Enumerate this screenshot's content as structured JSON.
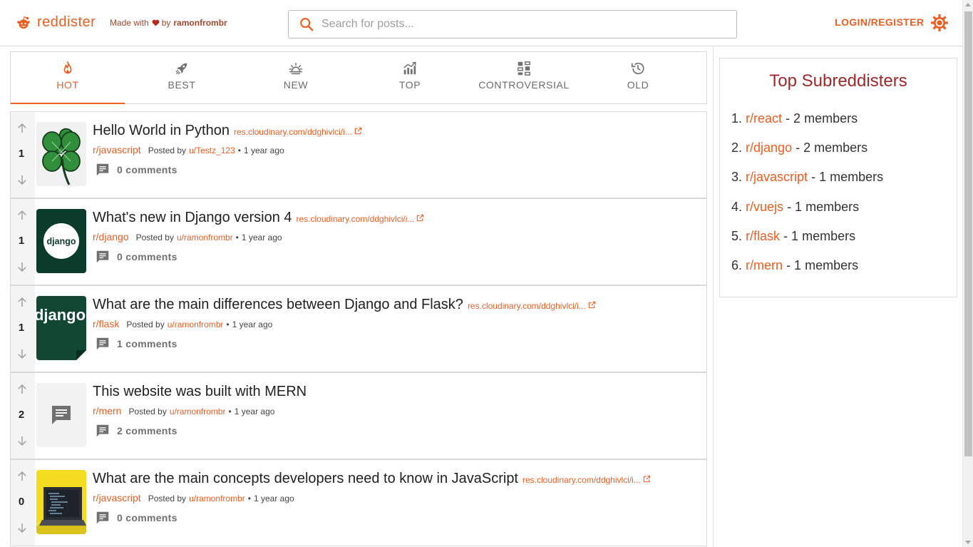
{
  "header": {
    "logo_text": "reddister",
    "made_with_prefix": "Made with",
    "made_with_by": "by",
    "made_with_author": "ramonfrombr",
    "search_placeholder": "Search for posts...",
    "login_label": "LOGIN/REGISTER"
  },
  "colors": {
    "accent": "#ee5d21",
    "sidebar_title": "#a1282a"
  },
  "tabs": [
    {
      "label": "HOT",
      "icon": "flame-icon",
      "active": true
    },
    {
      "label": "BEST",
      "icon": "rocket-icon",
      "active": false
    },
    {
      "label": "NEW",
      "icon": "sunrise-icon",
      "active": false
    },
    {
      "label": "TOP",
      "icon": "trending-chart-icon",
      "active": false
    },
    {
      "label": "CONTROVERSIAL",
      "icon": "controversial-icon",
      "active": false
    },
    {
      "label": "OLD",
      "icon": "history-icon",
      "active": false
    }
  ],
  "posts": [
    {
      "votes": "1",
      "title": "Hello World in Python",
      "link": "res.cloudinary.com/ddghivlci/i...",
      "subreddit": "r/javascript",
      "posted_by": "Posted by",
      "user": "u/Testz_123",
      "time": "1 year ago",
      "comments": "0 comments",
      "thumb": "clover"
    },
    {
      "votes": "1",
      "title": "What's new in Django version 4",
      "link": "res.cloudinary.com/ddghivlci/i...",
      "subreddit": "r/django",
      "posted_by": "Posted by",
      "user": "u/ramonfrombr",
      "time": "1 year ago",
      "comments": "0 comments",
      "thumb": "django-circle",
      "thumb_text": "django"
    },
    {
      "votes": "1",
      "title": "What are the main differences between Django and Flask?",
      "link": "res.cloudinary.com/ddghivlci/i...",
      "subreddit": "r/flask",
      "posted_by": "Posted by",
      "user": "u/ramonfrombr",
      "time": "1 year ago",
      "comments": "1 comments",
      "thumb": "django-wordmark",
      "thumb_text": "django"
    },
    {
      "votes": "2",
      "title": "This website was built with MERN",
      "link": "",
      "subreddit": "r/mern",
      "posted_by": "Posted by",
      "user": "u/ramonfrombr",
      "time": "1 year ago",
      "comments": "2 comments",
      "thumb": "text-post"
    },
    {
      "votes": "0",
      "title": "What are the main concepts developers need to know in JavaScript",
      "link": "res.cloudinary.com/ddghivlci/i...",
      "subreddit": "r/javascript",
      "posted_by": "Posted by",
      "user": "u/ramonfrombr",
      "time": "1 year ago",
      "comments": "0 comments",
      "thumb": "laptop-yellow"
    }
  ],
  "sidebar": {
    "title": "Top Subreddisters",
    "items": [
      {
        "rank": "1.",
        "name": "r/react",
        "members": "- 2 members"
      },
      {
        "rank": "2.",
        "name": "r/django",
        "members": "- 2 members"
      },
      {
        "rank": "3.",
        "name": "r/javascript",
        "members": "- 1 members"
      },
      {
        "rank": "4.",
        "name": "r/vuejs",
        "members": "- 1 members"
      },
      {
        "rank": "5.",
        "name": "r/flask",
        "members": "- 1 members"
      },
      {
        "rank": "6.",
        "name": "r/mern",
        "members": "- 1 members"
      }
    ]
  }
}
